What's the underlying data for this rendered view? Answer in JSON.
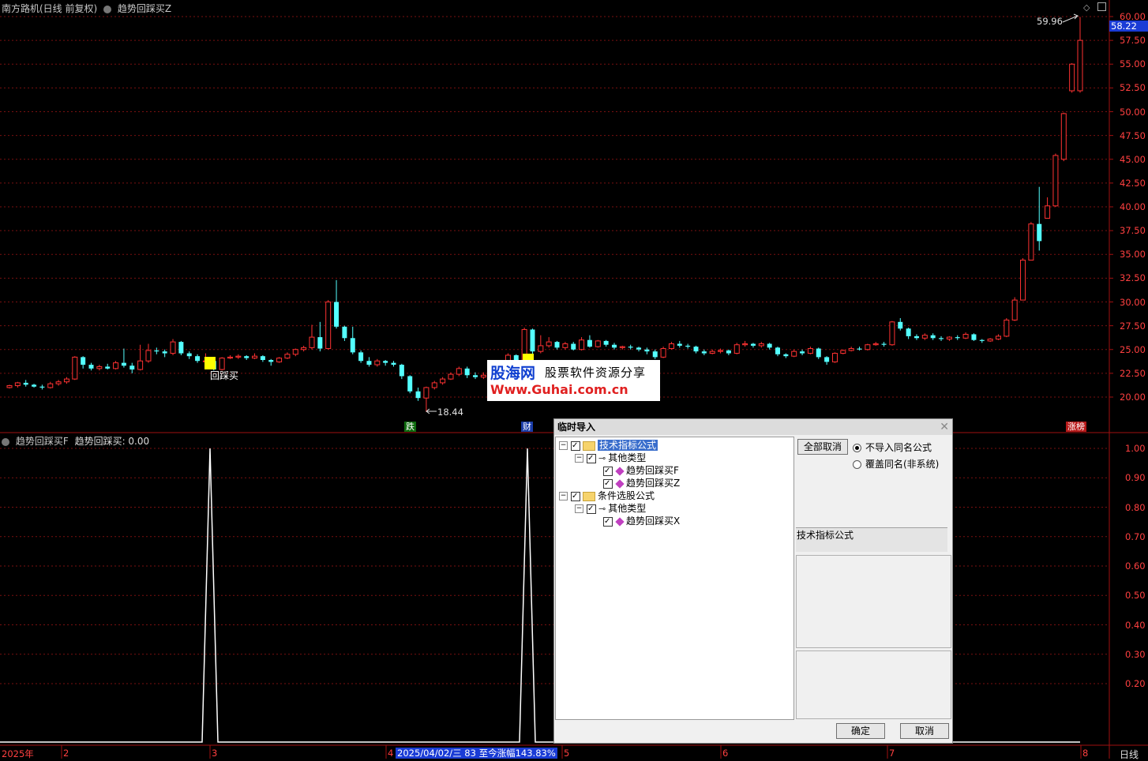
{
  "header": {
    "stock_title": "南方路机(日线 前复权)",
    "indicator_main": "趋势回踩买Z",
    "indicator_sub": "趋势回踩买F",
    "indicator_value": "趋势回踩买: 0.00"
  },
  "price_axis": [
    "60.00",
    "57.50",
    "55.00",
    "52.50",
    "50.00",
    "47.50",
    "45.00",
    "42.50",
    "40.00",
    "37.50",
    "35.00",
    "32.50",
    "30.00",
    "27.50",
    "25.00",
    "22.50",
    "20.00"
  ],
  "current_price": "58.22",
  "sub_axis": [
    "1.00",
    "0.90",
    "0.80",
    "0.70",
    "0.60",
    "0.50",
    "0.40",
    "0.30",
    "0.20"
  ],
  "annotations": {
    "high_label": "59.96",
    "low_label": "18.44",
    "signal_label": "回踩买",
    "tag_die": "跌",
    "tag_cai": "财",
    "tag_zhangting": "涨榜"
  },
  "colors": {
    "up": "#ff3232",
    "down": "#54ffff",
    "signal": "#ffff00",
    "grid": "#7a1010"
  },
  "time_axis": {
    "year": "2025年",
    "months": [
      "2",
      "3",
      "4",
      "5",
      "6",
      "7",
      "8"
    ],
    "range_info": "2025/04/02/三 83 至今涨幅143.83%",
    "period": "日线"
  },
  "watermark": {
    "name": "股海网",
    "slogan": "股票软件资源分享",
    "url": "Www.Guhai.com.cn"
  },
  "dialog": {
    "title": "临时导入",
    "tree": [
      {
        "label": "技术指标公式",
        "level": 0,
        "kind": "folder",
        "selected": true
      },
      {
        "label": "其他类型",
        "level": 1,
        "kind": "key"
      },
      {
        "label": "趋势回踩买F",
        "level": 2,
        "kind": "formula"
      },
      {
        "label": "趋势回踩买Z",
        "level": 2,
        "kind": "formula"
      },
      {
        "label": "条件选股公式",
        "level": 0,
        "kind": "folder"
      },
      {
        "label": "其他类型",
        "level": 1,
        "kind": "key"
      },
      {
        "label": "趋势回踩买X",
        "level": 2,
        "kind": "formula"
      }
    ],
    "deselect_all": "全部取消",
    "radio_options": [
      "不导入同名公式",
      "覆盖同名(非系统)"
    ],
    "info_label": "技术指标公式",
    "ok": "确定",
    "cancel": "取消"
  }
}
